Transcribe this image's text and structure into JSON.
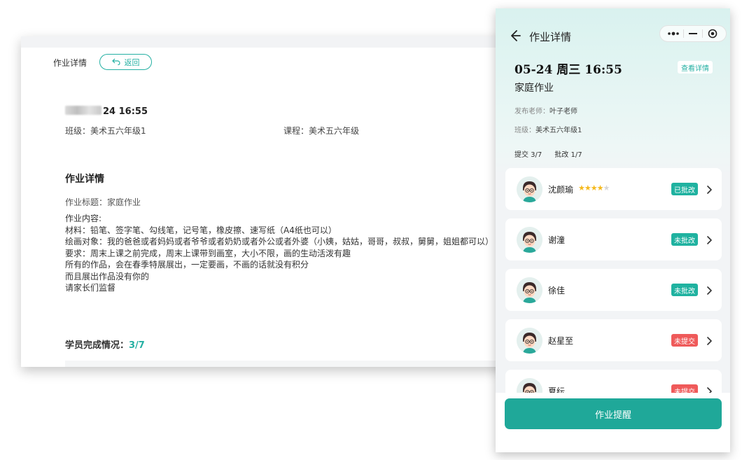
{
  "desktop": {
    "page_title": "作业详情",
    "back_label": "返回",
    "datetime_visible": "24 16:55",
    "class_label": "班级：",
    "class_value": "美术五六年级1",
    "course_label": "课程：",
    "course_value": "美术五六年级",
    "section_title": "作业详情",
    "subject_label": "作业标题：",
    "subject_value": "家庭作业",
    "content_lines": [
      "作业内容:",
      "材料：铅笔、签字笔、勾线笔，记号笔，橡皮擦、速写纸（A4纸也可以）",
      "绘画对象：我的爸爸或者妈妈或者爷爷或者奶奶或者外公或者外婆（小姨，姑姑，哥哥，叔叔，舅舅，姐姐都可以）",
      "要求：周末上课之前完成，周末上课带到画室，大小不限，画的生动活泼有趣",
      "所有的作品，会在春季特展展出，一定要画，不画的话就没有积分",
      "而且展出作品没有你的",
      "请家长们监督"
    ],
    "completion_label": "学员完成情况：",
    "completion_value": "3/7"
  },
  "mobile": {
    "nav_title": "作业详情",
    "icons": {
      "back": "arrow-left-icon",
      "more": "more-dots-icon",
      "minimize": "minimize-icon",
      "close": "target-close-icon"
    },
    "date": "05-24 周三 16:55",
    "view_detail_label": "查看详情",
    "homework_type": "家庭作业",
    "teacher_label": "发布老师：",
    "teacher_value": "叶子老师",
    "class_label": "班级：",
    "class_value": "美术五六年级1",
    "submitted": "提交 3/7",
    "graded": "批改 1/7",
    "students": [
      {
        "name": "沈颜瑜",
        "status": "已批改",
        "status_color": "#1fb2a0",
        "rating": 4,
        "rating_max": 5
      },
      {
        "name": "谢潼",
        "status": "未批改",
        "status_color": "#1fb2a0"
      },
      {
        "name": "徐佳",
        "status": "未批改",
        "status_color": "#1fb2a0"
      },
      {
        "name": "赵星至",
        "status": "未提交",
        "status_color": "#ef5a5a"
      },
      {
        "name": "夏纭",
        "status": "未提交",
        "status_color": "#ef5a5a"
      }
    ],
    "remind_button_label": "作业提醒",
    "accent_color": "#1fa899"
  }
}
